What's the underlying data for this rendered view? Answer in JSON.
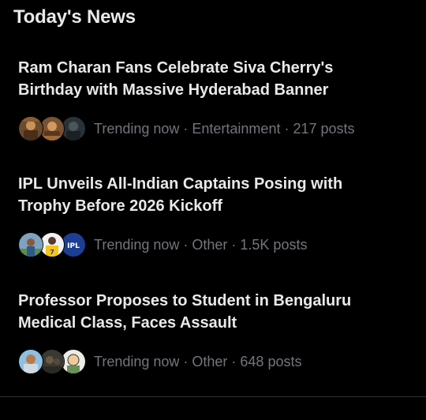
{
  "section": {
    "title": "Today's News"
  },
  "items": [
    {
      "headline": "Ram Charan Fans Celebrate Siva Cherry's Birthday with Massive Hyderabad Banner",
      "meta": "Trending now · Entertainment · 217 posts",
      "avatars": [
        "fan-banner-thumbnail",
        "fan-banner-thumbnail",
        "poster-thumbnail"
      ]
    },
    {
      "headline": "IPL Unveils All-Indian Captains Posing with Trophy Before 2026 Kickoff",
      "meta": "Trending now · Other · 1.5K posts",
      "avatars": [
        "player-thumbnail",
        "captain-thumbnail",
        "ipl-logo"
      ],
      "logo_text": "IPL"
    },
    {
      "headline": "Professor Proposes to Student in Bengaluru Medical Class, Faces Assault",
      "meta": "Trending now · Other · 648 posts",
      "avatars": [
        "person-thumbnail",
        "classroom-thumbnail",
        "cartoon-thumbnail"
      ]
    }
  ],
  "colors": {
    "background": "#000000",
    "headline": "#e7e9ea",
    "meta": "#71767b",
    "divider": "#2f3336",
    "ipl_blue": "#1c3f94"
  }
}
